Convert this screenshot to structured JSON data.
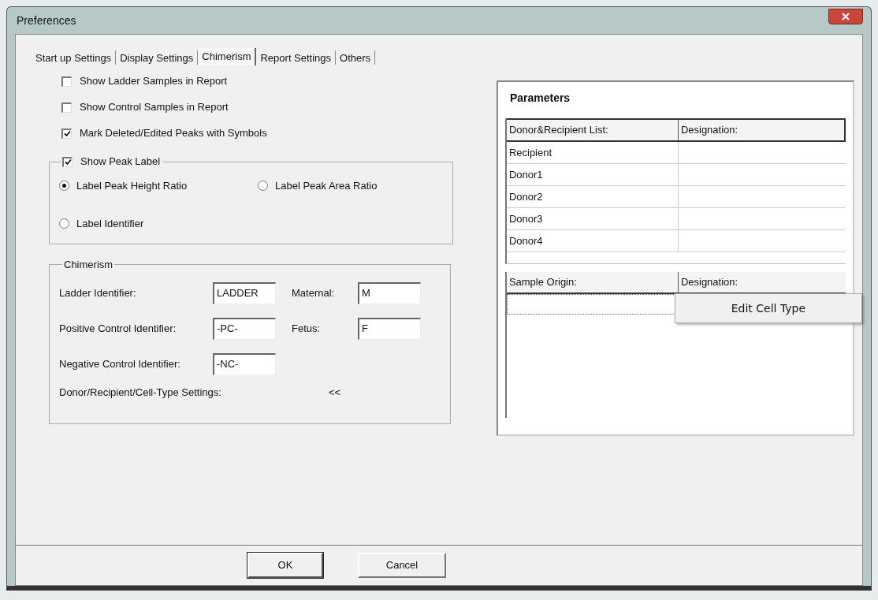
{
  "window": {
    "title": "Preferences"
  },
  "tabs": [
    {
      "label": "Start up Settings",
      "selected": false
    },
    {
      "label": "Display Settings",
      "selected": false
    },
    {
      "label": "Chimerism",
      "selected": true
    },
    {
      "label": "Report Settings",
      "selected": false
    },
    {
      "label": "Others",
      "selected": false
    }
  ],
  "options": [
    {
      "label": "Show Ladder Samples in Report",
      "checked": false
    },
    {
      "label": "Show Control Samples in Report",
      "checked": false
    },
    {
      "label": "Mark Deleted/Edited Peaks with Symbols",
      "checked": true
    }
  ],
  "peak_label": {
    "label": "Show Peak Label",
    "checked": true,
    "radios": [
      {
        "label": "Label Peak Height Ratio",
        "selected": true
      },
      {
        "label": "Label Peak Area Ratio",
        "selected": false
      },
      {
        "label": "Label Identifier",
        "selected": false
      }
    ]
  },
  "chimerism": {
    "title": "Chimerism",
    "fields": [
      {
        "label": "Ladder Identifier:",
        "value": "LADDER"
      },
      {
        "label": "Maternal:",
        "value": "M"
      },
      {
        "label": "Positive Control Identifier:",
        "value": "-PC-"
      },
      {
        "label": "Fetus:",
        "value": "F"
      },
      {
        "label": "Negative Control Identifier:",
        "value": "-NC-"
      }
    ],
    "settings_label": "Donor/Recipient/Cell-Type Settings:",
    "toggle": "<<"
  },
  "parameters": {
    "title": "Parameters",
    "donor_table": {
      "columns": [
        "Donor&Recipient List:",
        "Designation:"
      ],
      "rows": [
        "Recipient",
        "Donor1",
        "Donor2",
        "Donor3",
        "Donor4"
      ]
    },
    "sample_table": {
      "columns": [
        "Sample Origin:",
        "Designation:"
      ]
    },
    "context_menu": [
      "Edit Cell Type"
    ]
  },
  "buttons": [
    "OK",
    "Cancel"
  ]
}
